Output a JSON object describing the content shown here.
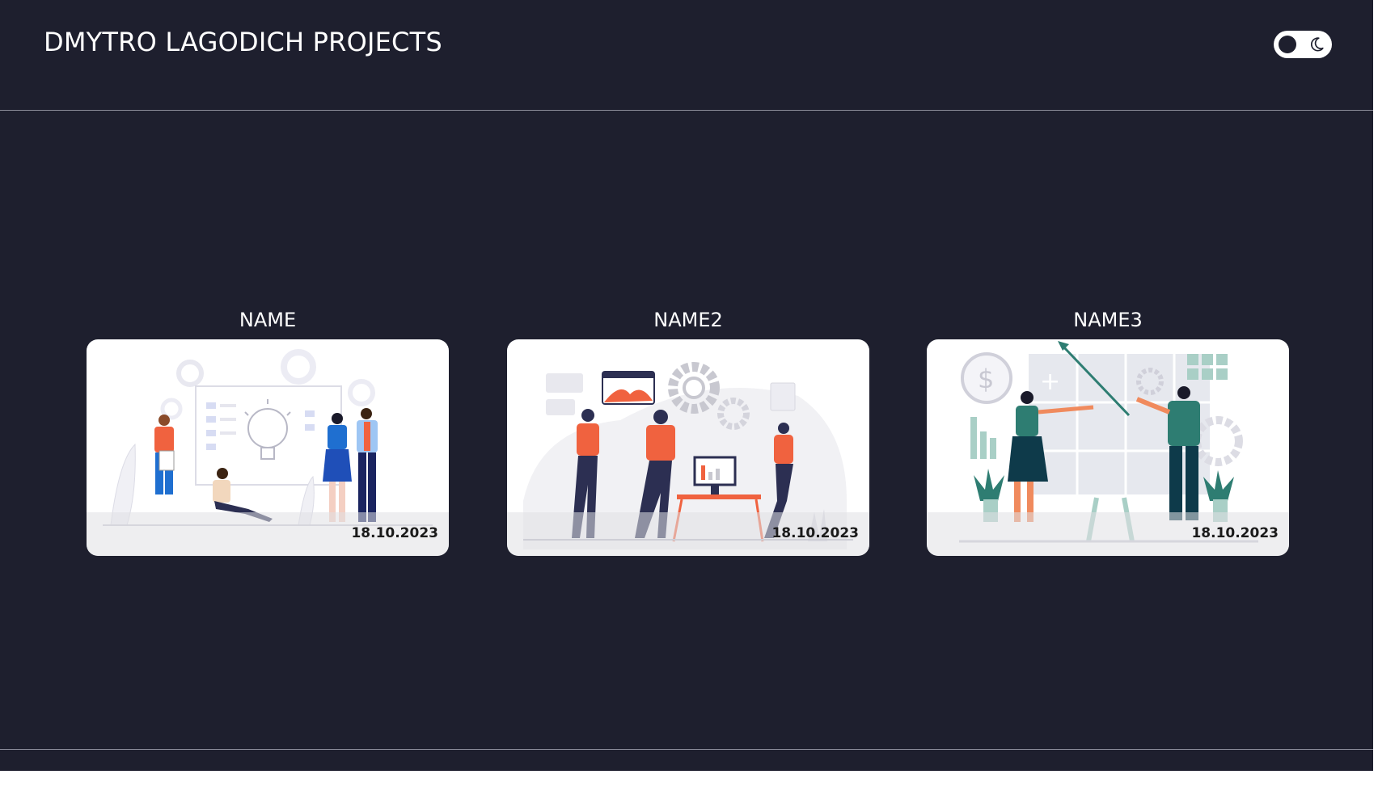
{
  "header": {
    "title": "DMYTRO LAGODICH PROJECTS",
    "theme_toggle": {
      "state": "dark",
      "icon": "moon-icon"
    }
  },
  "projects": [
    {
      "name": "NAME",
      "date": "18.10.2023",
      "illustration": "team-brainstorm-lightbulb-illustration"
    },
    {
      "name": "NAME2",
      "date": "18.10.2023",
      "illustration": "team-gears-analytics-illustration"
    },
    {
      "name": "NAME3",
      "date": "18.10.2023",
      "illustration": "business-growth-presentation-illustration"
    }
  ],
  "colors": {
    "background": "#1e1f2e",
    "divider": "#8b8c99",
    "text": "#ffffff",
    "card": "#ffffff",
    "accent_orange": "#f0623f",
    "accent_blue": "#1f4fb8",
    "accent_teal": "#2e7d72"
  }
}
